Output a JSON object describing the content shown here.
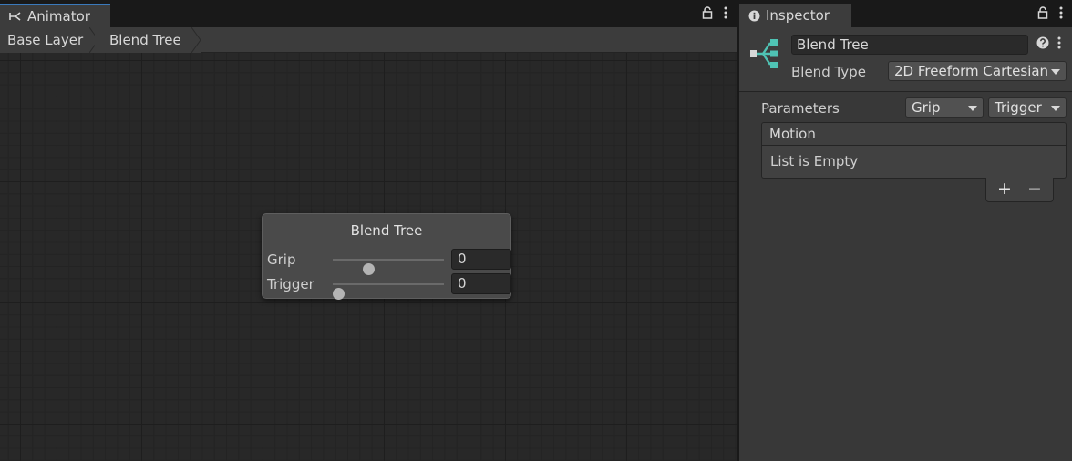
{
  "animator": {
    "tab_title": "Animator",
    "breadcrumb": [
      "Base Layer",
      "Blend Tree"
    ],
    "node": {
      "title": "Blend Tree",
      "params": [
        {
          "label": "Grip",
          "value": "0",
          "slider_fraction": 0.3
        },
        {
          "label": "Trigger",
          "value": "0",
          "slider_fraction": 0.0
        }
      ]
    }
  },
  "inspector": {
    "tab_title": "Inspector",
    "name": "Blend Tree",
    "blend_type_label": "Blend Type",
    "blend_type_value": "2D Freeform Cartesian",
    "parameters_label": "Parameters",
    "param_x": "Grip",
    "param_y": "Trigger",
    "motion_header": "Motion",
    "list_empty_text": "List is Empty",
    "add_label": "+",
    "remove_label": "−"
  },
  "icons": [
    "animator-icon",
    "lock-icon",
    "kebab-menu-icon",
    "info-icon",
    "blend-tree-icon",
    "help-icon"
  ],
  "colors": {
    "accent": "#3a79bb",
    "blend_tree_icon": "#4fc3b4",
    "panel": "#383838",
    "graph": "#282828"
  }
}
